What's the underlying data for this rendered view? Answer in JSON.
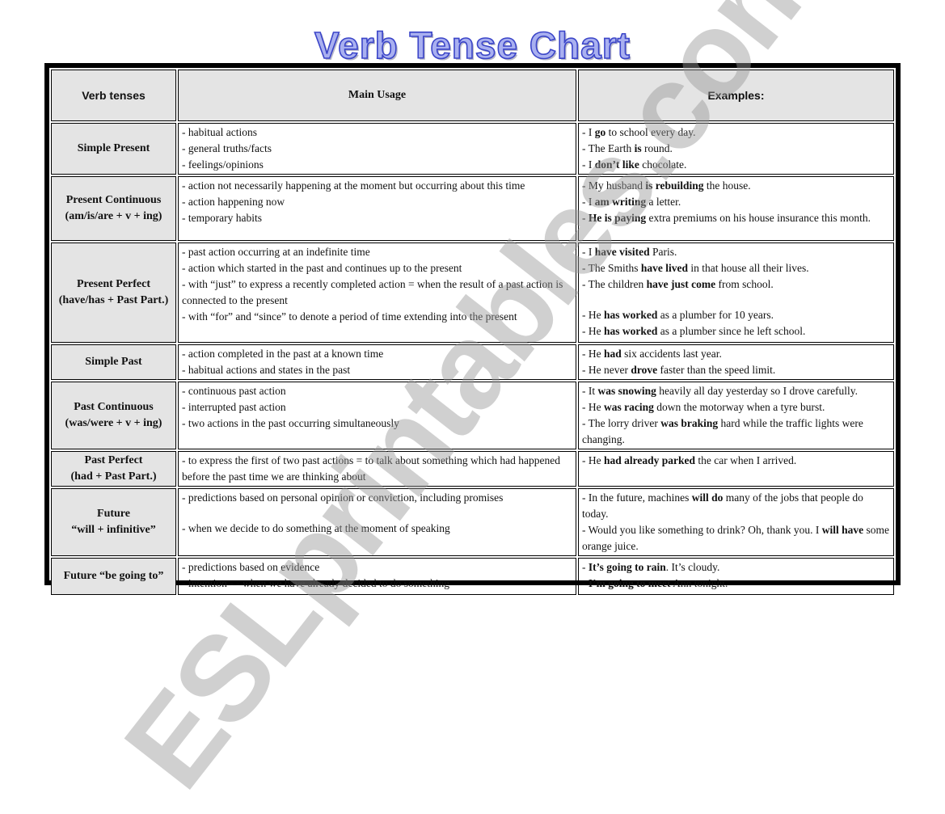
{
  "title": "Verb Tense Chart",
  "watermark": "ESLprintables.com",
  "headers": {
    "tenses": "Verb tenses",
    "usage": "Main Usage",
    "examples": "Examples:"
  },
  "rows": [
    {
      "tense": [
        "Simple Present"
      ],
      "usage": [
        "- habitual actions",
        "- general truths/facts",
        "- feelings/opinions"
      ],
      "examples": [
        [
          [
            "- I ",
            false
          ],
          [
            "go",
            true
          ],
          [
            " to school every day.",
            false
          ]
        ],
        [
          [
            "- The Earth ",
            false
          ],
          [
            "is",
            true
          ],
          [
            " round.",
            false
          ]
        ],
        [
          [
            "- I ",
            false
          ],
          [
            "don’t like",
            true
          ],
          [
            " chocolate.",
            false
          ]
        ]
      ]
    },
    {
      "tense": [
        "Present Continuous",
        "(am/is/are + v + ing)"
      ],
      "usage": [
        "- action not necessarily happening at the moment but occurring about this time",
        "- action happening now",
        "- temporary habits"
      ],
      "examples": [
        [
          [
            "- My husband ",
            false
          ],
          [
            "is rebuilding",
            true
          ],
          [
            " the house.",
            false
          ]
        ],
        [
          [
            "- I ",
            false
          ],
          [
            "am writing",
            true
          ],
          [
            " a letter.",
            false
          ]
        ],
        [
          [
            "- ",
            false
          ],
          [
            "He is paying",
            true
          ],
          [
            " extra premiums on his house insurance this month.",
            false
          ]
        ]
      ]
    },
    {
      "tense": [
        "Present Perfect",
        "(have/has + Past Part.)"
      ],
      "usage": [
        "- past action occurring at an indefinite time",
        "- action which started in the past and continues up to the present",
        "- with “just” to express a recently completed action = when the result of a past action is connected to the present",
        "- with “for” and “since” to denote a period of time extending into the present"
      ],
      "examples": [
        [
          [
            "- I ",
            false
          ],
          [
            "have visited",
            true
          ],
          [
            " Paris.",
            false
          ]
        ],
        [
          [
            "- The Smiths ",
            false
          ],
          [
            "have lived",
            true
          ],
          [
            " in that house all their lives.",
            false
          ]
        ],
        [
          [
            "- The children ",
            false
          ],
          [
            "have just come",
            true
          ],
          [
            " from school.",
            false
          ]
        ],
        [],
        [
          [
            "- He ",
            false
          ],
          [
            "has worked",
            true
          ],
          [
            " as a plumber for 10 years.",
            false
          ]
        ],
        [
          [
            "- He ",
            false
          ],
          [
            "has worked",
            true
          ],
          [
            " as a plumber since he left school.",
            false
          ]
        ]
      ]
    },
    {
      "tense": [
        "Simple Past"
      ],
      "usage": [
        "- action completed in the past at a known time",
        "- habitual actions and states in the past"
      ],
      "examples": [
        [
          [
            "- He ",
            false
          ],
          [
            "had",
            true
          ],
          [
            " six accidents last year.",
            false
          ]
        ],
        [
          [
            "- He never ",
            false
          ],
          [
            "drove",
            true
          ],
          [
            " faster than the speed limit.",
            false
          ]
        ]
      ]
    },
    {
      "tense": [
        "Past Continuous",
        "(was/were + v + ing)"
      ],
      "usage": [
        "- continuous past action",
        "- interrupted past action",
        "- two actions in the past occurring simultaneously"
      ],
      "examples": [
        [
          [
            "- It ",
            false
          ],
          [
            "was snowing",
            true
          ],
          [
            " heavily all day yesterday so I drove carefully.",
            false
          ]
        ],
        [
          [
            "- He ",
            false
          ],
          [
            "was racing",
            true
          ],
          [
            " down the motorway when a tyre burst.",
            false
          ]
        ],
        [
          [
            "- The lorry driver ",
            false
          ],
          [
            "was braking",
            true
          ],
          [
            " hard while the traffic lights were changing.",
            false
          ]
        ]
      ]
    },
    {
      "tense": [
        "Past Perfect",
        "(had + Past Part.)"
      ],
      "usage": [
        "- to express the first of two past actions = to talk about something which had happened before the past time we are thinking about"
      ],
      "examples": [
        [
          [
            "- He ",
            false
          ],
          [
            "had already parked",
            true
          ],
          [
            " the car when I arrived.",
            false
          ]
        ]
      ]
    },
    {
      "tense": [
        "Future",
        "“will + infinitive”"
      ],
      "usage": [
        "- predictions based on personal opinion or conviction, including promises",
        "",
        "- when we decide to do something at the moment of speaking"
      ],
      "examples": [
        [
          [
            "- In the future, machines ",
            false
          ],
          [
            "will do",
            true
          ],
          [
            " many of the jobs that people do today.",
            false
          ]
        ],
        [
          [
            "- Would you like something to drink? Oh, thank you. I ",
            false
          ],
          [
            "will have",
            true
          ],
          [
            " some orange juice.",
            false
          ]
        ]
      ]
    },
    {
      "tense": [
        "Future “be going to”"
      ],
      "usage": [
        "- predictions based on evidence",
        "- intention - - when we have already decided to do something"
      ],
      "examples": [
        [
          [
            "- ",
            false
          ],
          [
            "It’s going to rain",
            true
          ],
          [
            ". It’s cloudy.",
            false
          ]
        ],
        [
          [
            "- ",
            false
          ],
          [
            "I’m going to meet",
            true
          ],
          [
            " Ann tonight.",
            false
          ]
        ]
      ]
    }
  ]
}
